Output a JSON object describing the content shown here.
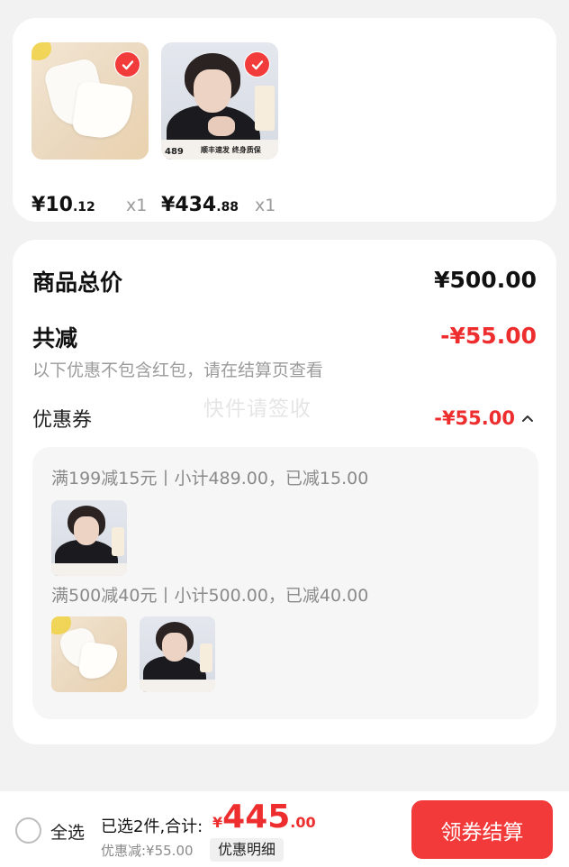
{
  "products": [
    {
      "image": "white-socks",
      "price_symbol": "¥",
      "price_int": "10",
      "price_dec": ".12",
      "qty": "x1",
      "checked": true
    },
    {
      "image": "portrait-product-489",
      "price_symbol": "¥",
      "price_int": "434",
      "price_dec": ".88",
      "qty": "x1",
      "checked": true
    }
  ],
  "summary": {
    "total_label": "商品总价",
    "total_value": "¥500.00",
    "reduce_label": "共减",
    "reduce_value": "-¥55.00",
    "note": "以下优惠不包含红包，请在结算页查看",
    "coupon_label": "优惠券",
    "coupon_value": "-¥55.00",
    "watermark": "快件请签收"
  },
  "coupons": [
    {
      "rule": "满199减15元丨小计489.00，已减15.00",
      "items": [
        "portrait-product-489"
      ]
    },
    {
      "rule": "满500减40元丨小计500.00，已减40.00",
      "items": [
        "white-socks",
        "portrait-product-489"
      ]
    }
  ],
  "bottom_bar": {
    "select_all": "全选",
    "selected_text": "已选2件,合计:",
    "total_symbol": "¥",
    "total_int": "445",
    "total_dec": ".00",
    "discount_text": "优惠减:¥55.00",
    "detail_button": "优惠明细",
    "checkout_button": "领券结算"
  },
  "portrait_banner": {
    "price": "489",
    "text": "顺丰速发 终身质保"
  },
  "colors": {
    "accent": "#ee2e2e",
    "button": "#f23a3a",
    "page_bg": "#f2f2f2"
  }
}
